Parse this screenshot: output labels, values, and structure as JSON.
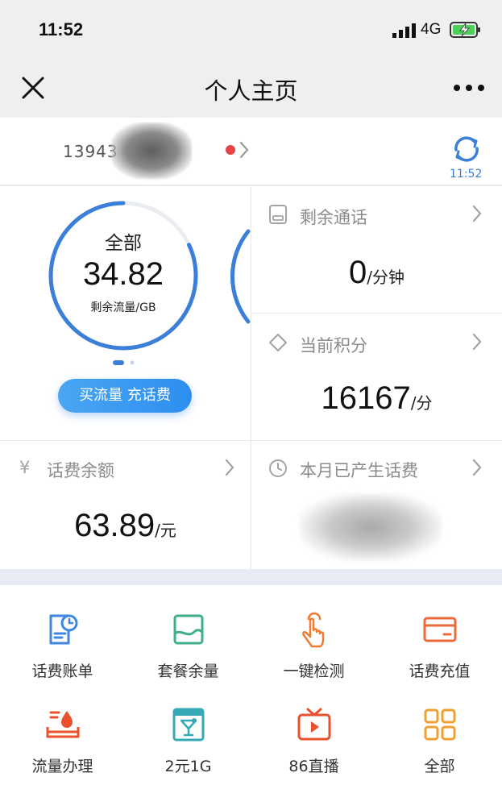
{
  "status": {
    "time": "11:52",
    "network": "4G"
  },
  "nav": {
    "title": "个人主页"
  },
  "account": {
    "phone": "13943",
    "refresh_time": "11:52"
  },
  "data_card": {
    "label": "全部",
    "value": "34.82",
    "unit": "剩余流量/GB",
    "remaining_fraction": 0.82,
    "buy_button": "买流量 充话费"
  },
  "call_card": {
    "title": "剩余通话",
    "value": "0",
    "unit": "/分钟"
  },
  "points_card": {
    "title": "当前积分",
    "value": "16167",
    "unit": "/分"
  },
  "balance_card": {
    "currency_symbol": "¥",
    "title": "话费余额",
    "value": "63.89",
    "unit": "/元"
  },
  "month_card": {
    "title": "本月已产生话费"
  },
  "services": [
    {
      "label": "话费账单",
      "icon": "bill-icon",
      "color": "#3f86e0"
    },
    {
      "label": "套餐余量",
      "icon": "package-icon",
      "color": "#3fae8c"
    },
    {
      "label": "一键检测",
      "icon": "tap-hand-icon",
      "color": "#ef7a2e"
    },
    {
      "label": "话费充值",
      "icon": "card-icon",
      "color": "#ea6a3a"
    },
    {
      "label": "流量办理",
      "icon": "data-drop-icon",
      "color": "#e8502e"
    },
    {
      "label": "2元1G",
      "icon": "cocktail-icon",
      "color": "#35a9b6"
    },
    {
      "label": "86直播",
      "icon": "tv-play-icon",
      "color": "#e8502e"
    },
    {
      "label": "全部",
      "icon": "grid-icon",
      "color": "#f0a030"
    }
  ],
  "colors": {
    "accent_blue": "#3c7fd8",
    "alert_red": "#e64343"
  }
}
